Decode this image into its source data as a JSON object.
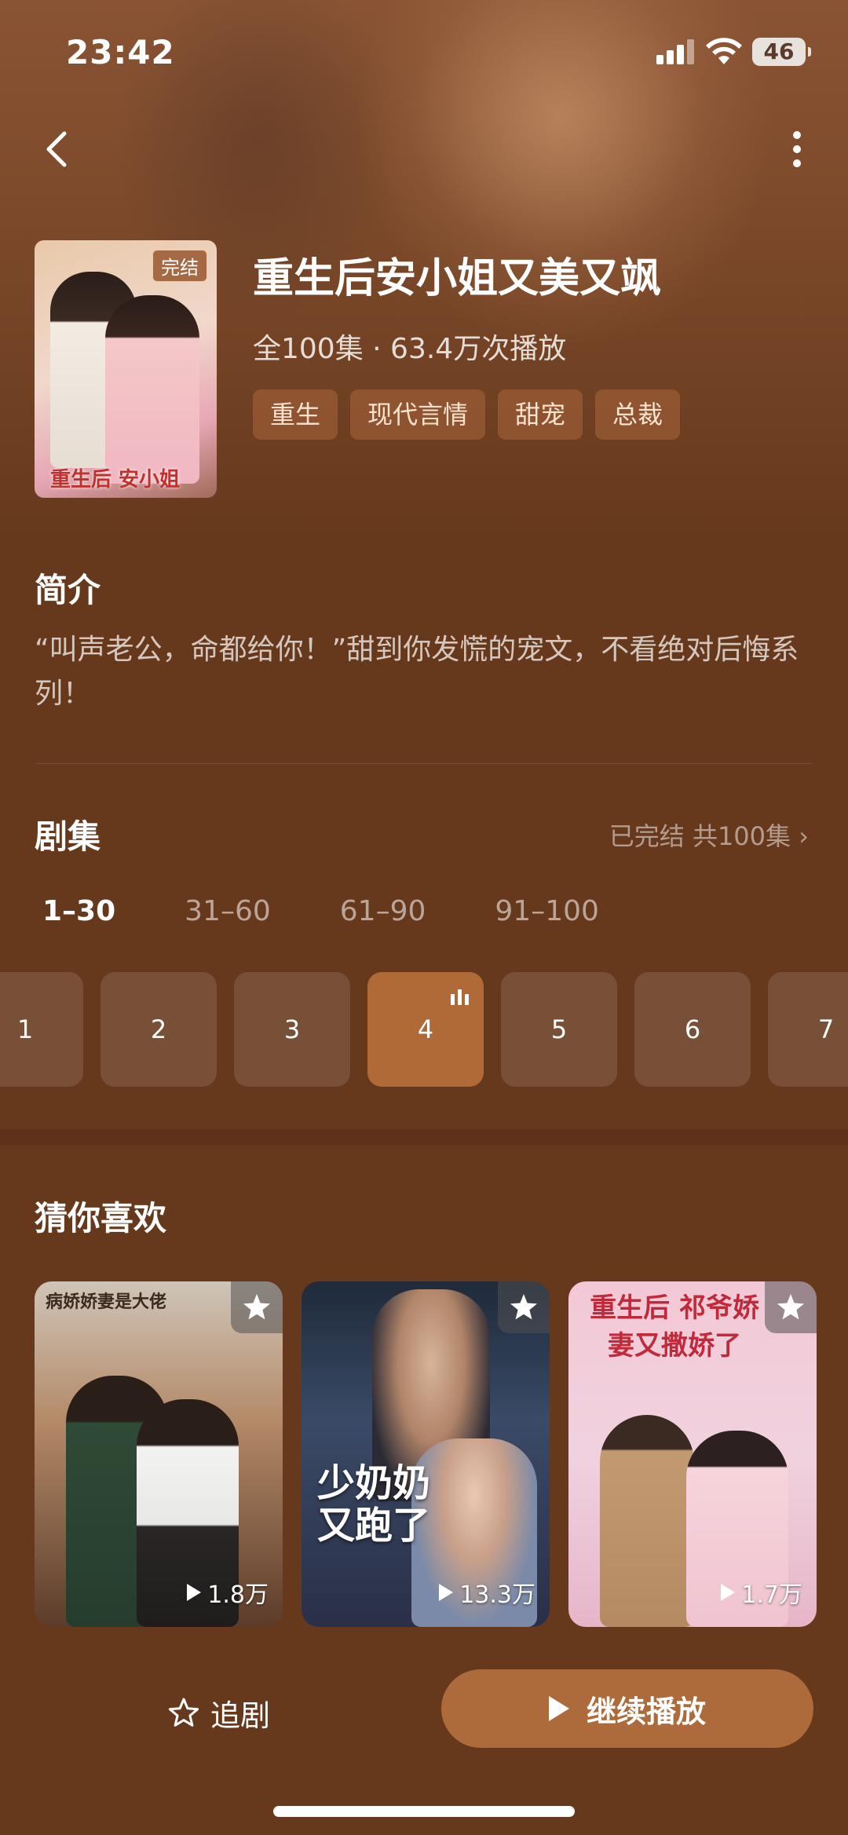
{
  "status_bar": {
    "time": "23:42",
    "battery": "46"
  },
  "drama": {
    "completed_badge": "完结",
    "poster_title": "重生后 安小姐",
    "title": "重生后安小姐又美又飒",
    "meta": "全100集 · 63.4万次播放",
    "tags": [
      "重生",
      "现代言情",
      "甜宠",
      "总裁"
    ]
  },
  "synopsis": {
    "heading": "简介",
    "text": "“叫声老公，命都给你！”甜到你发慌的宠文，不看绝对后悔系列！"
  },
  "episodes": {
    "heading": "剧集",
    "summary": "已完结 共100集 ›",
    "ranges": [
      "1–30",
      "31–60",
      "61–90",
      "91–100"
    ],
    "active_range": "1–30",
    "items": [
      "1",
      "2",
      "3",
      "4",
      "5",
      "6",
      "7"
    ],
    "current": "4"
  },
  "recommend": {
    "heading": "猜你喜欢",
    "items": [
      {
        "plays": "1.8万",
        "cover_text": "病娇娇妻是大佬"
      },
      {
        "plays": "13.3万",
        "cover_text": "少奶奶又跑了"
      },
      {
        "plays": "1.7万",
        "cover_text": "重生后 祁爷娇妻又撒娇了"
      }
    ]
  },
  "actions": {
    "follow": "追剧",
    "play": "继续播放"
  },
  "colors": {
    "accent": "#ad6a3a",
    "background": "#66381c"
  }
}
